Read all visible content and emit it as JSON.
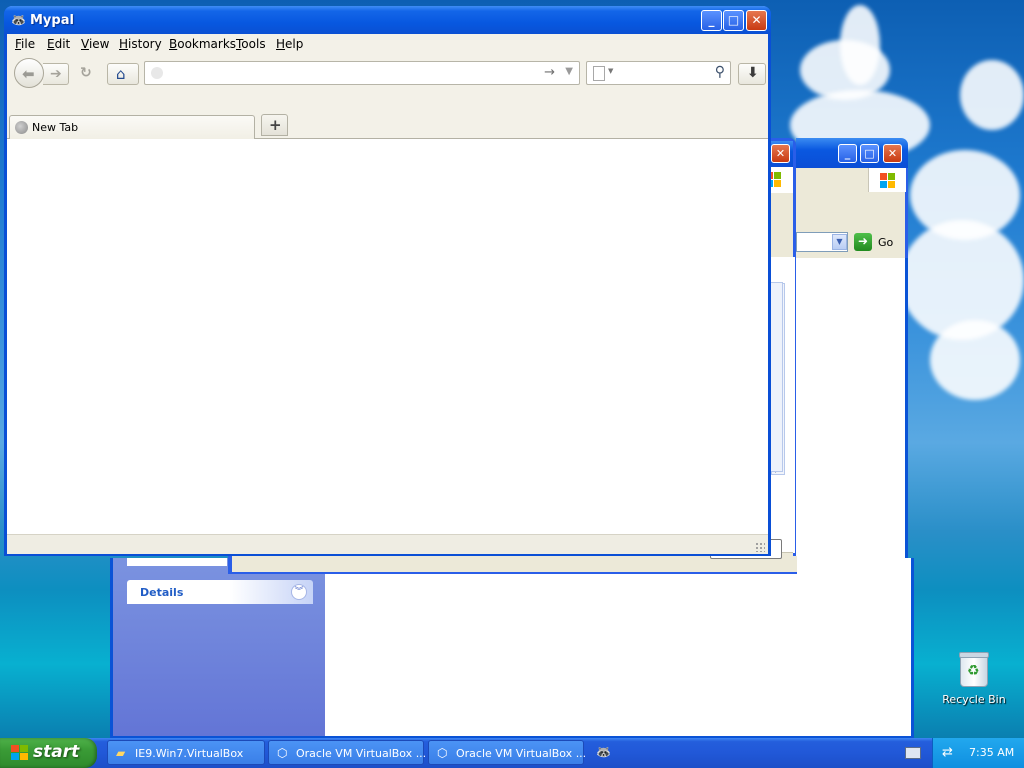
{
  "desktop": {
    "recycle_bin_label": "Recycle Bin"
  },
  "mypal": {
    "title": "Mypal",
    "menu": [
      "File",
      "Edit",
      "View",
      "History",
      "Bookmarks",
      "Tools",
      "Help"
    ],
    "menu_access_keys": [
      "F",
      "E",
      "V",
      "H",
      "B",
      "T",
      "H"
    ],
    "url_value": "",
    "search_value": "",
    "tabs": [
      {
        "label": "New Tab"
      }
    ]
  },
  "explorer": {
    "details_label": "Details"
  },
  "ie": {
    "go_label": "Go"
  },
  "taskbar": {
    "start_label": "start",
    "items": [
      {
        "label": "IE9.Win7.VirtualBox",
        "icon": "folder-icon"
      },
      {
        "label": "Oracle VM VirtualBox ...",
        "icon": "virtualbox-icon"
      },
      {
        "label": "Oracle VM VirtualBox ...",
        "icon": "virtualbox-icon"
      },
      {
        "label": "",
        "icon": "mypal-icon"
      }
    ],
    "clock": "7:35 AM"
  },
  "colors": {
    "titlebar_blue": "#0a58e0",
    "start_green": "#3a9b36",
    "taskbar_blue": "#245edc",
    "tray_blue": "#0f8fe0"
  }
}
